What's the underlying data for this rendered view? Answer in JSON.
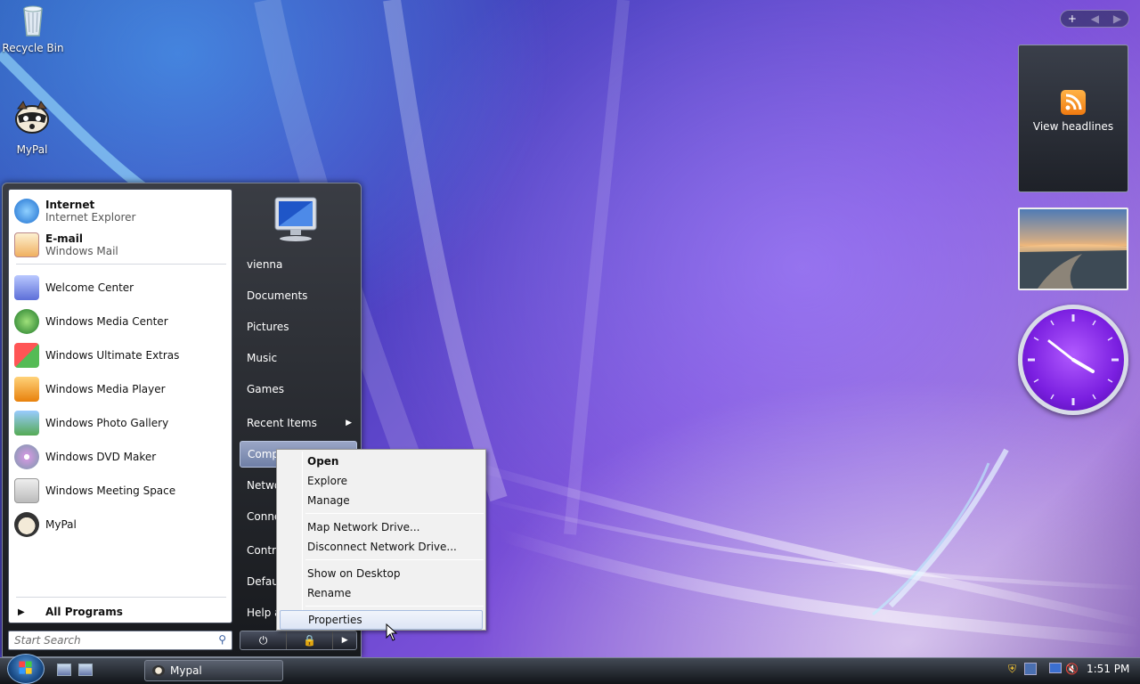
{
  "desktop": {
    "icons": [
      {
        "label": "Recycle Bin"
      },
      {
        "label": "MyPal"
      }
    ]
  },
  "sidebar": {
    "controls": {
      "add": "+",
      "prev": "◀",
      "next": "▶"
    },
    "feed_gadget": {
      "label": "View headlines"
    }
  },
  "start_menu": {
    "pinned": [
      {
        "title": "Internet",
        "subtitle": "Internet Explorer"
      },
      {
        "title": "E-mail",
        "subtitle": "Windows Mail"
      }
    ],
    "recent": [
      {
        "label": "Welcome Center"
      },
      {
        "label": "Windows Media Center"
      },
      {
        "label": "Windows Ultimate Extras"
      },
      {
        "label": "Windows Media Player"
      },
      {
        "label": "Windows Photo Gallery"
      },
      {
        "label": "Windows DVD Maker"
      },
      {
        "label": "Windows Meeting Space"
      },
      {
        "label": "MyPal"
      }
    ],
    "all_programs": "All Programs",
    "search_placeholder": "Start Search",
    "right": [
      {
        "label": "vienna"
      },
      {
        "label": "Documents"
      },
      {
        "label": "Pictures"
      },
      {
        "label": "Music"
      },
      {
        "label": "Games"
      },
      {
        "label": "Recent Items"
      },
      {
        "label": "Comp"
      },
      {
        "label": "Netwo"
      },
      {
        "label": "Conne"
      },
      {
        "label": "Contro"
      },
      {
        "label": "Defau"
      },
      {
        "label": "Help a"
      }
    ]
  },
  "context_menu": {
    "items": [
      {
        "label": "Open"
      },
      {
        "label": "Explore"
      },
      {
        "label": "Manage"
      },
      {
        "label": "Map Network Drive..."
      },
      {
        "label": "Disconnect Network Drive..."
      },
      {
        "label": "Show on Desktop"
      },
      {
        "label": "Rename"
      },
      {
        "label": "Properties"
      }
    ]
  },
  "taskbar": {
    "window_button": "Mypal",
    "clock": "1:51 PM"
  },
  "colors": {
    "accent": "#7a1fe0",
    "menu_highlight": "#dde5f5",
    "taskbar": "#1b1e24"
  }
}
